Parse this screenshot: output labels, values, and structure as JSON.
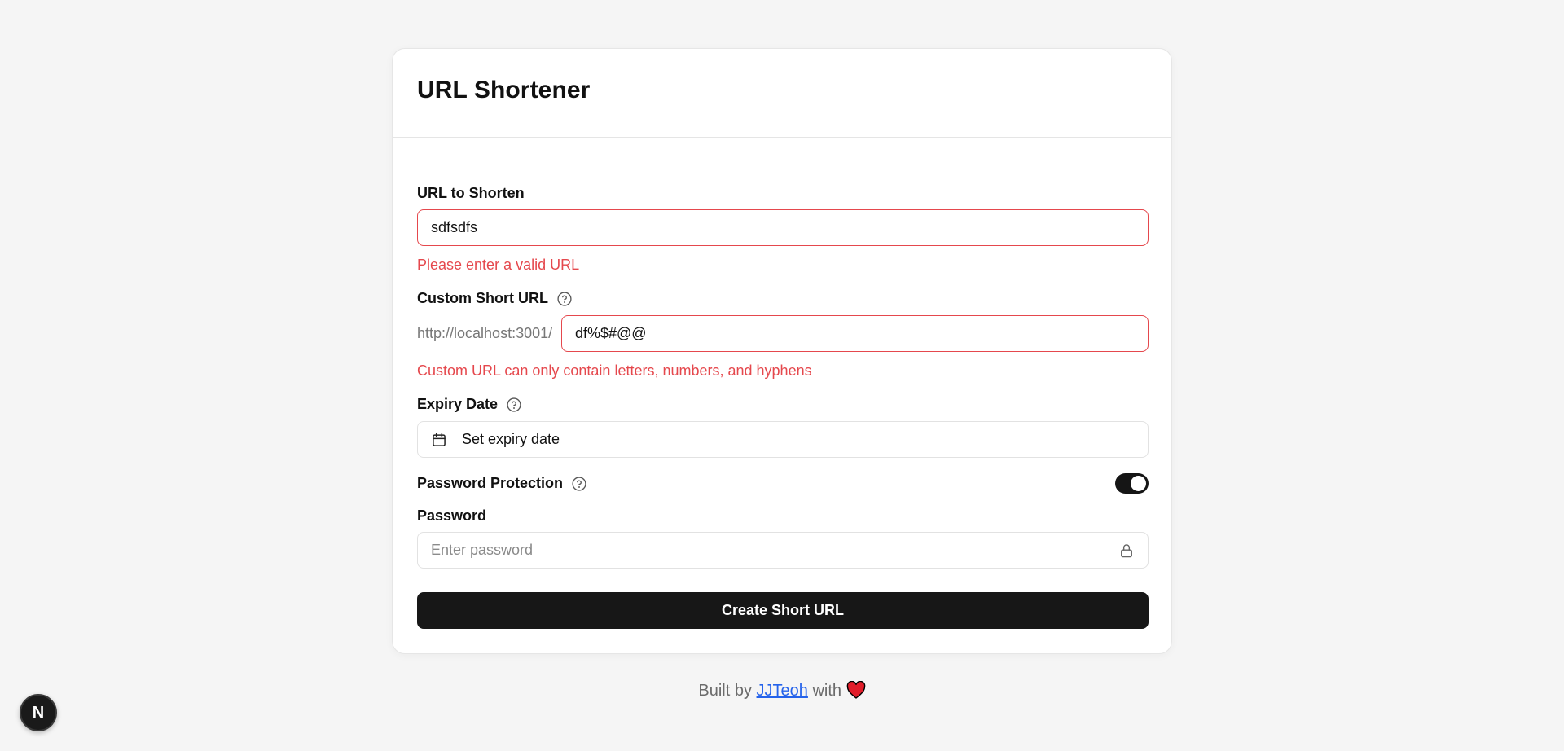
{
  "card": {
    "title": "URL Shortener"
  },
  "url_field": {
    "label": "URL to Shorten",
    "value": "sdfsdfs",
    "error": "Please enter a valid URL"
  },
  "custom_field": {
    "label": "Custom Short URL",
    "prefix": "http://localhost:3001/",
    "value": "df%$#@@",
    "error": "Custom URL can only contain letters, numbers, and hyphens"
  },
  "expiry": {
    "label": "Expiry Date",
    "button_text": "Set expiry date"
  },
  "password_protection": {
    "label": "Password Protection",
    "enabled": true
  },
  "password": {
    "label": "Password",
    "placeholder": "Enter password"
  },
  "submit_label": "Create Short URL",
  "footer": {
    "prefix": "Built by",
    "author": "JJTeoh",
    "suffix": "with"
  },
  "badge": {
    "letter": "N"
  },
  "colors": {
    "error": "#e5484d",
    "primary": "#171717",
    "link": "#2563eb",
    "heart": "#e11d2a"
  }
}
